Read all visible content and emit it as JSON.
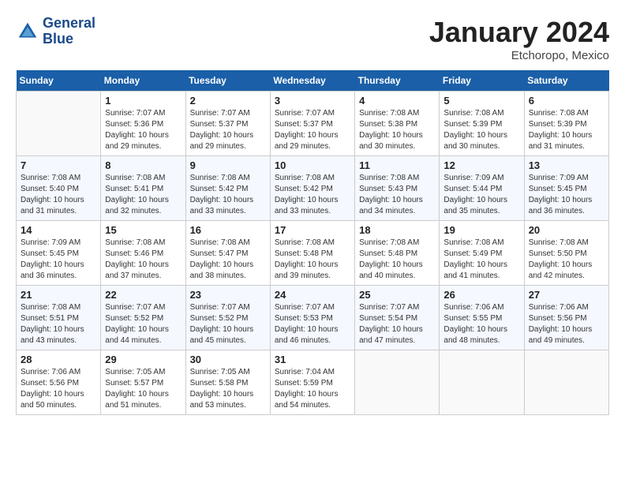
{
  "header": {
    "logo_line1": "General",
    "logo_line2": "Blue",
    "month_title": "January 2024",
    "location": "Etchoropo, Mexico"
  },
  "weekdays": [
    "Sunday",
    "Monday",
    "Tuesday",
    "Wednesday",
    "Thursday",
    "Friday",
    "Saturday"
  ],
  "weeks": [
    [
      {
        "day": "",
        "sunrise": "",
        "sunset": "",
        "daylight": ""
      },
      {
        "day": "1",
        "sunrise": "7:07 AM",
        "sunset": "5:36 PM",
        "daylight": "10 hours and 29 minutes."
      },
      {
        "day": "2",
        "sunrise": "7:07 AM",
        "sunset": "5:37 PM",
        "daylight": "10 hours and 29 minutes."
      },
      {
        "day": "3",
        "sunrise": "7:07 AM",
        "sunset": "5:37 PM",
        "daylight": "10 hours and 29 minutes."
      },
      {
        "day": "4",
        "sunrise": "7:08 AM",
        "sunset": "5:38 PM",
        "daylight": "10 hours and 30 minutes."
      },
      {
        "day": "5",
        "sunrise": "7:08 AM",
        "sunset": "5:39 PM",
        "daylight": "10 hours and 30 minutes."
      },
      {
        "day": "6",
        "sunrise": "7:08 AM",
        "sunset": "5:39 PM",
        "daylight": "10 hours and 31 minutes."
      }
    ],
    [
      {
        "day": "7",
        "sunrise": "7:08 AM",
        "sunset": "5:40 PM",
        "daylight": "10 hours and 31 minutes."
      },
      {
        "day": "8",
        "sunrise": "7:08 AM",
        "sunset": "5:41 PM",
        "daylight": "10 hours and 32 minutes."
      },
      {
        "day": "9",
        "sunrise": "7:08 AM",
        "sunset": "5:42 PM",
        "daylight": "10 hours and 33 minutes."
      },
      {
        "day": "10",
        "sunrise": "7:08 AM",
        "sunset": "5:42 PM",
        "daylight": "10 hours and 33 minutes."
      },
      {
        "day": "11",
        "sunrise": "7:08 AM",
        "sunset": "5:43 PM",
        "daylight": "10 hours and 34 minutes."
      },
      {
        "day": "12",
        "sunrise": "7:09 AM",
        "sunset": "5:44 PM",
        "daylight": "10 hours and 35 minutes."
      },
      {
        "day": "13",
        "sunrise": "7:09 AM",
        "sunset": "5:45 PM",
        "daylight": "10 hours and 36 minutes."
      }
    ],
    [
      {
        "day": "14",
        "sunrise": "7:09 AM",
        "sunset": "5:45 PM",
        "daylight": "10 hours and 36 minutes."
      },
      {
        "day": "15",
        "sunrise": "7:08 AM",
        "sunset": "5:46 PM",
        "daylight": "10 hours and 37 minutes."
      },
      {
        "day": "16",
        "sunrise": "7:08 AM",
        "sunset": "5:47 PM",
        "daylight": "10 hours and 38 minutes."
      },
      {
        "day": "17",
        "sunrise": "7:08 AM",
        "sunset": "5:48 PM",
        "daylight": "10 hours and 39 minutes."
      },
      {
        "day": "18",
        "sunrise": "7:08 AM",
        "sunset": "5:48 PM",
        "daylight": "10 hours and 40 minutes."
      },
      {
        "day": "19",
        "sunrise": "7:08 AM",
        "sunset": "5:49 PM",
        "daylight": "10 hours and 41 minutes."
      },
      {
        "day": "20",
        "sunrise": "7:08 AM",
        "sunset": "5:50 PM",
        "daylight": "10 hours and 42 minutes."
      }
    ],
    [
      {
        "day": "21",
        "sunrise": "7:08 AM",
        "sunset": "5:51 PM",
        "daylight": "10 hours and 43 minutes."
      },
      {
        "day": "22",
        "sunrise": "7:07 AM",
        "sunset": "5:52 PM",
        "daylight": "10 hours and 44 minutes."
      },
      {
        "day": "23",
        "sunrise": "7:07 AM",
        "sunset": "5:52 PM",
        "daylight": "10 hours and 45 minutes."
      },
      {
        "day": "24",
        "sunrise": "7:07 AM",
        "sunset": "5:53 PM",
        "daylight": "10 hours and 46 minutes."
      },
      {
        "day": "25",
        "sunrise": "7:07 AM",
        "sunset": "5:54 PM",
        "daylight": "10 hours and 47 minutes."
      },
      {
        "day": "26",
        "sunrise": "7:06 AM",
        "sunset": "5:55 PM",
        "daylight": "10 hours and 48 minutes."
      },
      {
        "day": "27",
        "sunrise": "7:06 AM",
        "sunset": "5:56 PM",
        "daylight": "10 hours and 49 minutes."
      }
    ],
    [
      {
        "day": "28",
        "sunrise": "7:06 AM",
        "sunset": "5:56 PM",
        "daylight": "10 hours and 50 minutes."
      },
      {
        "day": "29",
        "sunrise": "7:05 AM",
        "sunset": "5:57 PM",
        "daylight": "10 hours and 51 minutes."
      },
      {
        "day": "30",
        "sunrise": "7:05 AM",
        "sunset": "5:58 PM",
        "daylight": "10 hours and 53 minutes."
      },
      {
        "day": "31",
        "sunrise": "7:04 AM",
        "sunset": "5:59 PM",
        "daylight": "10 hours and 54 minutes."
      },
      {
        "day": "",
        "sunrise": "",
        "sunset": "",
        "daylight": ""
      },
      {
        "day": "",
        "sunrise": "",
        "sunset": "",
        "daylight": ""
      },
      {
        "day": "",
        "sunrise": "",
        "sunset": "",
        "daylight": ""
      }
    ]
  ]
}
